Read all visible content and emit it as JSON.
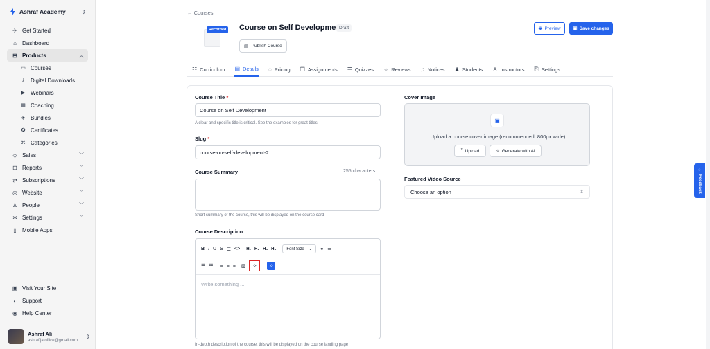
{
  "sidebar": {
    "brand": "Ashraf Academy",
    "items": [
      {
        "label": "Get Started",
        "icon": "rocket-icon",
        "glyph": "✈"
      },
      {
        "label": "Dashboard",
        "icon": "home-icon",
        "glyph": "⌂"
      },
      {
        "label": "Products",
        "icon": "box-icon",
        "glyph": "⊞"
      }
    ],
    "products_sub": [
      {
        "label": "Courses",
        "icon": "monitor-icon",
        "glyph": "▭"
      },
      {
        "label": "Digital Downloads",
        "icon": "download-icon",
        "glyph": "⤓"
      },
      {
        "label": "Webinars",
        "icon": "video-icon",
        "glyph": "▶"
      },
      {
        "label": "Coaching",
        "icon": "calendar-icon",
        "glyph": "▦"
      },
      {
        "label": "Bundles",
        "icon": "bundle-icon",
        "glyph": "◈"
      },
      {
        "label": "Certificates",
        "icon": "certificate-icon",
        "glyph": "✪"
      },
      {
        "label": "Categories",
        "icon": "tag-icon",
        "glyph": "⌘"
      }
    ],
    "items2": [
      {
        "label": "Sales",
        "icon": "sales-tag-icon",
        "glyph": "◇"
      },
      {
        "label": "Reports",
        "icon": "reports-icon",
        "glyph": "⊟"
      },
      {
        "label": "Subscriptions",
        "icon": "subscriptions-icon",
        "glyph": "⇄"
      },
      {
        "label": "Website",
        "icon": "globe-icon",
        "glyph": "◎"
      },
      {
        "label": "People",
        "icon": "person-icon",
        "glyph": "♙"
      },
      {
        "label": "Settings",
        "icon": "gear-icon",
        "glyph": "✲"
      }
    ],
    "mobile": {
      "label": "Mobile Apps",
      "icon": "phone-icon",
      "glyph": "▯"
    },
    "bottom": [
      {
        "label": "Visit Your Site",
        "icon": "site-icon",
        "glyph": "▣"
      },
      {
        "label": "Support",
        "icon": "headset-icon",
        "glyph": "◐"
      },
      {
        "label": "Help Center",
        "icon": "help-icon",
        "glyph": "◉"
      }
    ],
    "user": {
      "name": "Ashraf Ali",
      "email": "ashrafija.office@gmail.com"
    }
  },
  "header": {
    "back_label": "Courses",
    "thumb_tag": "Recorded",
    "title": "Course on Self Development",
    "status": "Draft",
    "publish_label": "Publish Course",
    "preview_label": "Preview",
    "save_label": "Save changes"
  },
  "tabs": [
    {
      "label": "Curriculum",
      "glyph": "☷",
      "icon": "curriculum-icon"
    },
    {
      "label": "Details",
      "glyph": "▤",
      "icon": "details-icon"
    },
    {
      "label": "Pricing",
      "glyph": "◌",
      "icon": "pricing-icon"
    },
    {
      "label": "Assignments",
      "glyph": "❐",
      "icon": "assignments-icon"
    },
    {
      "label": "Quizzes",
      "glyph": "☰",
      "icon": "quizzes-icon"
    },
    {
      "label": "Reviews",
      "glyph": "☆",
      "icon": "star-icon"
    },
    {
      "label": "Notices",
      "glyph": "♫",
      "icon": "bell-icon"
    },
    {
      "label": "Students",
      "glyph": "♟",
      "icon": "students-icon"
    },
    {
      "label": "Instructors",
      "glyph": "♙",
      "icon": "instructor-icon"
    },
    {
      "label": "Settings",
      "glyph": "⎘",
      "icon": "settings-icon"
    }
  ],
  "form": {
    "title_label": "Course Title",
    "title_value": "Course on Self Development",
    "title_hint": "A clear and specific title is critical. See the examples for great titles.",
    "slug_label": "Slug",
    "slug_value": "course-on-self-development-2",
    "summary_label": "Course Summary",
    "summary_counter": "255 characters",
    "summary_hint": "Short summary of the course, this will be displayed on the course card",
    "description_label": "Course Description",
    "font_size_label": "Font Size",
    "editor_placeholder": "Write something ...",
    "description_hint": "In-depth description of the course, this will be displayed on the course landing page",
    "cover_label": "Cover Image",
    "cover_text": "Upload a course cover image (recommended: 800px wide)",
    "upload_label": "Upload",
    "generate_label": "Generate with AI",
    "video_label": "Featured Video Source",
    "video_value": "Choose an option"
  },
  "feedback_label": "Feedback",
  "colors": {
    "accent": "#2563eb",
    "required": "#dc2626",
    "highlight": "#dc2626"
  }
}
